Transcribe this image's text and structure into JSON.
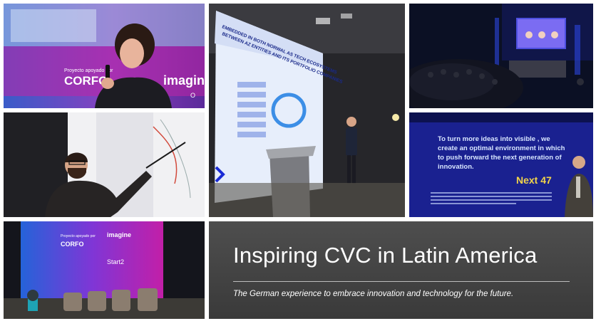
{
  "banner": {
    "title": "Inspiring CVC in Latin America",
    "subtitle": "The German experience to embrace innovation and technology for the future."
  },
  "photos": {
    "speaker_woman": {
      "stage_text_1": "Proyecto apoyado por",
      "stage_text_2": "CORFO",
      "stage_text_3": "imagin",
      "stage_text_4": "O"
    },
    "podium_slide": {
      "slide_text_1": "EMBEDDED IN BOTH NORWAL AS TECH ECOSYSTEMS",
      "slide_text_2": "BETWEEN AZ ENTITIES AND ITS PORTFOLIO COMPANIES"
    },
    "next47_slide": {
      "slide_text_1": "To turn more ideas into visible , we",
      "slide_text_2": "create an optimal environment in which",
      "slide_text_3": "to push forward the next generation of",
      "slide_text_4": "innovation.",
      "slide_brand": "Next 47"
    },
    "empty_stage": {
      "screen_text_1": "Proyecto apoyado por",
      "screen_text_2": "CORFO",
      "screen_text_3": "imagine",
      "screen_text_4": "Start2"
    }
  },
  "colors": {
    "banner_bg": "#424242",
    "stage_magenta": "#c21fa8",
    "stage_blue": "#1c2fb8",
    "slide_blue": "#1a2bd6",
    "next47_accent": "#f2d44a"
  }
}
